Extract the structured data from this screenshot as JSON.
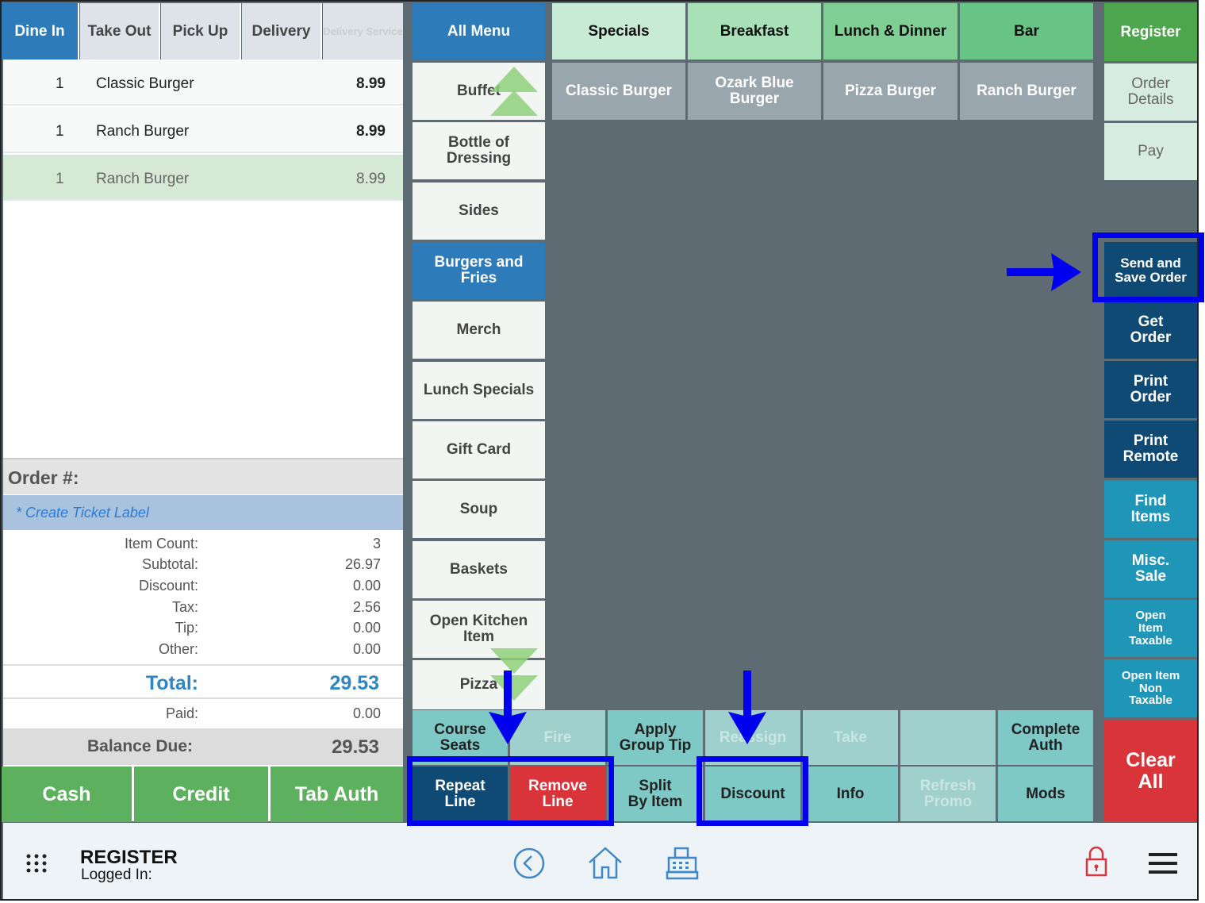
{
  "order_types": [
    {
      "label": "Dine In",
      "active": true
    },
    {
      "label": "Take Out"
    },
    {
      "label": "Pick Up"
    },
    {
      "label": "Delivery"
    },
    {
      "label": "Delivery Service",
      "disabled": true
    }
  ],
  "lines": [
    {
      "qty": "1",
      "name": "Classic Burger",
      "price": "8.99"
    },
    {
      "qty": "1",
      "name": "Ranch Burger",
      "price": "8.99"
    },
    {
      "qty": "1",
      "name": "Ranch Burger",
      "price": "8.99",
      "selected": true
    }
  ],
  "order_label": "Order #:",
  "ticket_label": "* Create Ticket Label",
  "summary": [
    {
      "label": "Item Count:",
      "value": "3"
    },
    {
      "label": "Subtotal:",
      "value": "26.97"
    },
    {
      "label": "Discount:",
      "value": "0.00"
    },
    {
      "label": "Tax:",
      "value": "2.56"
    },
    {
      "label": "Tip:",
      "value": "0.00"
    },
    {
      "label": "Other:",
      "value": "0.00"
    }
  ],
  "total": {
    "label": "Total:",
    "value": "29.53"
  },
  "paid": {
    "label": "Paid:",
    "value": "0.00"
  },
  "balance": {
    "label": "Balance Due:",
    "value": "29.53"
  },
  "pay_buttons": [
    "Cash",
    "Credit",
    "Tab Auth"
  ],
  "categories": [
    "All Menu",
    "Buffet",
    "Bottle of Dressing",
    "Sides",
    "Burgers and Fries",
    "Merch",
    "Lunch Specials",
    "Gift Card",
    "Soup",
    "Baskets",
    "Open Kitchen Item",
    "Pizza"
  ],
  "groups": [
    "Specials",
    "Breakfast",
    "Lunch & Dinner",
    "Bar"
  ],
  "items": [
    "Classic Burger",
    "Ozark Blue Burger",
    "Pizza Burger",
    "Ranch Burger"
  ],
  "right_buttons": [
    "Register",
    "Order Details",
    "Pay",
    "Send and Save Order",
    "Get Order",
    "Print Order",
    "Print Remote",
    "Find Items",
    "Misc. Sale",
    "Open Item Taxable",
    "Open Item Non Taxable",
    "Clear All"
  ],
  "bottom_row1": [
    "Course Seats",
    "Fire",
    "Apply Group Tip",
    "Reassign",
    "Take",
    "",
    "Complete Auth"
  ],
  "bottom_row2": [
    "Repeat Line",
    "Remove Line",
    "Split By Item",
    "Discount",
    "Info",
    "Refresh Promo",
    "Mods"
  ],
  "footer": {
    "title": "REGISTER",
    "logged_in": "Logged In:"
  },
  "colors": {
    "blue": "#2d7bb8",
    "navy": "#0e4a73",
    "teal": "#1f96b8",
    "green": "#5db05d",
    "red": "#d9343a",
    "highlight": "#0000ee"
  },
  "icons": [
    "grid-icon",
    "back-icon",
    "home-icon",
    "register-icon",
    "lock-icon",
    "menu-icon"
  ]
}
